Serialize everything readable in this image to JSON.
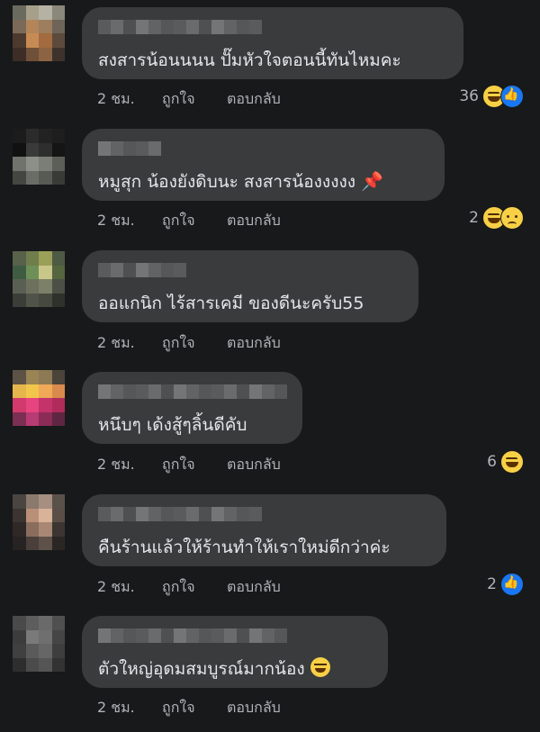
{
  "actions": {
    "like": "ถูกใจ",
    "reply": "ตอบกลับ"
  },
  "comments": [
    {
      "text": "สงสารน้อนนนน  ปั๊มหัวใจตอนนี้ทันไหมคะ",
      "time": "2 ชม.",
      "reaction_count": "36",
      "reactions": [
        "haha-icon",
        "like-icon"
      ],
      "avatar_colors": [
        "#6b6a5e",
        "#a6a08b",
        "#b5b2a3",
        "#8a877b",
        "#7b6a58",
        "#b38559",
        "#9d7e5e",
        "#6e6458",
        "#4d3a2e",
        "#c68b54",
        "#a36b3f",
        "#5c4b3c",
        "#3c2e26",
        "#6f5038",
        "#8c6443",
        "#3d332c"
      ]
    },
    {
      "text": "หมูสุก น้องยังดิบนะ สงสารน้องงงงง",
      "inline_emoji": "pushpin-icon",
      "time": "2 ชม.",
      "reaction_count": "2",
      "reactions": [
        "haha-icon",
        "sad-icon"
      ],
      "avatar_colors": [
        "#1c1c1c",
        "#2b2b2b",
        "#222",
        "#1e1e1e",
        "#111",
        "#3a3a3a",
        "#2e2e2e",
        "#151515",
        "#6f736b",
        "#8c8f88",
        "#7b7e76",
        "#5c5e58",
        "#444741",
        "#6a6d65",
        "#585a54",
        "#393b36"
      ]
    },
    {
      "text": "ออแกนิก ไร้สารเคมี ของดีนะครับ55",
      "time": "2 ชม.",
      "reaction_count": "",
      "reactions": [],
      "avatar_colors": [
        "#58614a",
        "#717d4c",
        "#9ba058",
        "#4e5a43",
        "#3f5c43",
        "#6e8f57",
        "#c9c68a",
        "#55653f",
        "#5a5f53",
        "#6e705e",
        "#7d8068",
        "#4c4f45",
        "#3a3d38",
        "#505448",
        "#46493f",
        "#2f312c"
      ]
    },
    {
      "text": "หนึบๆ เด้งสู้ๆลิ้นดีคับ",
      "time": "2 ชม.",
      "reaction_count": "6",
      "reactions": [
        "haha-icon"
      ],
      "avatar_colors": [
        "#5c5346",
        "#9a8453",
        "#8d7a55",
        "#4a443b",
        "#e4b64c",
        "#f2c64b",
        "#f0a957",
        "#d98b4d",
        "#d23a6e",
        "#e6457f",
        "#c4336a",
        "#b02c5a",
        "#7b2f52",
        "#b73b74",
        "#8a2c56",
        "#5f2641"
      ]
    },
    {
      "text": "คืนร้านแล้วให้ร้านทำให้เราใหม่ดีกว่าค่ะ",
      "time": "2 ชม.",
      "reaction_count": "2",
      "reactions": [
        "like-icon"
      ],
      "avatar_colors": [
        "#4a4541",
        "#8a7a6e",
        "#a68f80",
        "#5a514b",
        "#3c3431",
        "#b98f78",
        "#d8b39a",
        "#5b4e46",
        "#2f2826",
        "#8a6d5c",
        "#a88774",
        "#3d3531",
        "#272322",
        "#4a3f3a",
        "#5e514a",
        "#2a2624"
      ]
    },
    {
      "text": "ตัวใหญ่อุดมสมบูรณ์มากน้อง",
      "inline_emoji": "grin-icon",
      "time": "2 ชม.",
      "reaction_count": "",
      "reactions": [],
      "avatar_colors": [
        "#4a4a4a",
        "#5d5d5d",
        "#6a6a6a",
        "#505050",
        "#3c3c3c",
        "#7a7a7a",
        "#6f6f6f",
        "#454545",
        "#404040",
        "#5a5a5a",
        "#666",
        "#3e3e3e",
        "#2e2e2e",
        "#4b4b4b",
        "#555",
        "#333"
      ]
    }
  ]
}
